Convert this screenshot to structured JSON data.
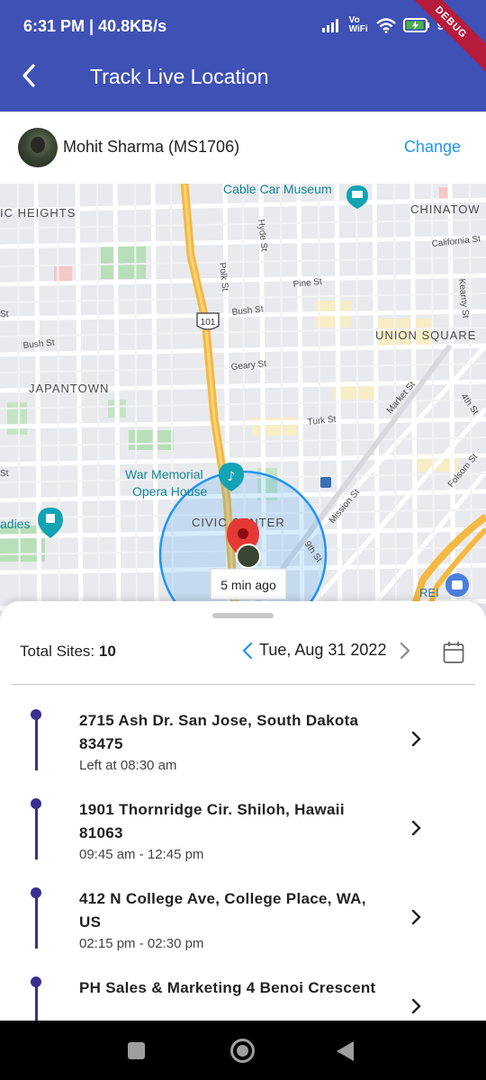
{
  "status_bar": {
    "text": "6:31 PM | 40.8KB/s",
    "network": "Vo WiFi",
    "battery": "9",
    "debug_label": "DEBUG"
  },
  "app_bar": {
    "title": "Track Live Location",
    "back_icon": "back-arrow-icon"
  },
  "user": {
    "name": "Mohit Sharma (MS1706)",
    "change_label": "Change"
  },
  "map": {
    "labels": {
      "cable_car": "Cable Car Museum",
      "heights": "IC HEIGHTS",
      "chinatown": "CHINATOW",
      "california": "California St",
      "hyde": "Hyde St",
      "polk": "Polk St",
      "pine": "Pine St",
      "kearny": "Kearny St",
      "hwy": "101",
      "bush1": "Bush St",
      "bush2": "Bush St",
      "st_left1": "St",
      "st_left2": "St",
      "union_square": "UNION SQUARE",
      "geary": "Geary St",
      "japantown": "JAPANTOWN",
      "market": "Market St",
      "fourth": "4th St",
      "turk": "Turk St",
      "war_memorial_1": "War Memorial",
      "war_memorial_2": "Opera House",
      "folsom": "Folsom St",
      "mission": "Mission St",
      "civic_center": "CIVIC CENTER",
      "ninth": "9th St",
      "ladies": "adies",
      "rei": "REI"
    },
    "marker_label": "5 min ago",
    "colors": {
      "accent_circle": "#2196f3",
      "freeway": "#f4b942",
      "pin": "#e53935"
    }
  },
  "sheet": {
    "total_label": "Total Sites:",
    "total_value": "10",
    "date": "Tue, Aug 31 2022",
    "sites": [
      {
        "address": "2715 Ash Dr. San Jose, South Dakota 83475",
        "time": "Left at 08:30 am"
      },
      {
        "address": "1901 Thornridge Cir. Shiloh, Hawaii 81063",
        "time": "09:45 am - 12:45 pm"
      },
      {
        "address": "412 N College Ave, College Place, WA, US",
        "time": "02:15 pm - 02:30 pm"
      },
      {
        "address": "PH Sales & Marketing 4 Benoi Crescent",
        "time": ""
      }
    ]
  },
  "colors": {
    "app_bar": "#3f51b5",
    "link": "#2196f3",
    "timeline": "#3b2f8f"
  }
}
